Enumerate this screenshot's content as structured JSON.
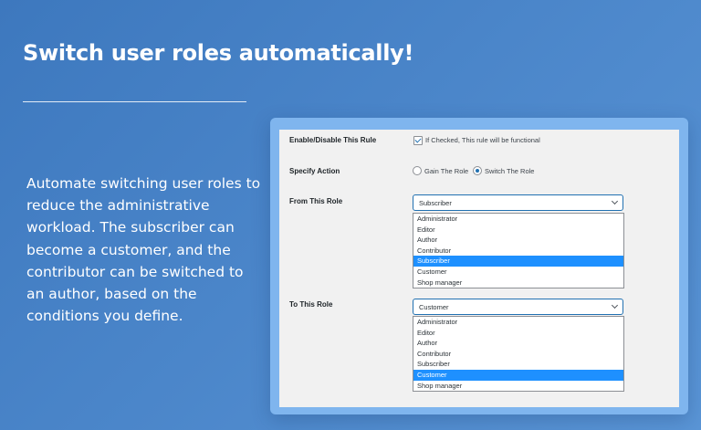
{
  "headline": "Switch user roles automatically!",
  "description": "Automate switching user roles to reduce the administrative workload. The subscriber can become a customer, and the contributor can be switched to an author, based on the conditions you define.",
  "colors": {
    "background": "#4a85c9",
    "frame": "#7fb5ee",
    "accent": "#2271b1",
    "highlight": "#1e90ff"
  },
  "form": {
    "enable": {
      "label": "Enable/Disable This Rule",
      "checkbox_text": "If Checked, This rule will be functional",
      "checked": true
    },
    "action": {
      "label": "Specify Action",
      "options": [
        "Gain The Role",
        "Switch The Role"
      ],
      "selected": "Switch The Role"
    },
    "from": {
      "label": "From This Role",
      "selected": "Subscriber",
      "options": [
        "Administrator",
        "Editor",
        "Author",
        "Contributor",
        "Subscriber",
        "Customer",
        "Shop manager"
      ]
    },
    "to": {
      "label": "To This Role",
      "selected": "Customer",
      "options": [
        "Administrator",
        "Editor",
        "Author",
        "Contributor",
        "Subscriber",
        "Customer",
        "Shop manager"
      ]
    }
  }
}
